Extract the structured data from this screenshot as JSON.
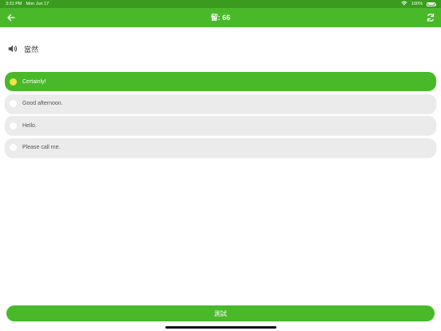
{
  "status_bar": {
    "time": "3:31 PM",
    "date": "Mon Jun 17",
    "battery_text": "100%",
    "icons": [
      "wifi-icon",
      "battery-icon"
    ]
  },
  "nav": {
    "title": "留: 66",
    "back_icon": "arrow-left-icon",
    "refresh_icon": "refresh-icon"
  },
  "prompt": {
    "text": "當然",
    "audio_icon": "speaker-icon"
  },
  "options": [
    {
      "label": "Certainly!",
      "selected": true
    },
    {
      "label": "Good afternoon.",
      "selected": false
    },
    {
      "label": "Hello.",
      "selected": false
    },
    {
      "label": "Please call me.",
      "selected": false
    }
  ],
  "test_button": {
    "label": "測試"
  },
  "colors": {
    "primary_green": "#49b92a",
    "status_green": "#3a9c1f",
    "option_gray": "#ebebeb",
    "selected_radio": "#f3e24a"
  }
}
